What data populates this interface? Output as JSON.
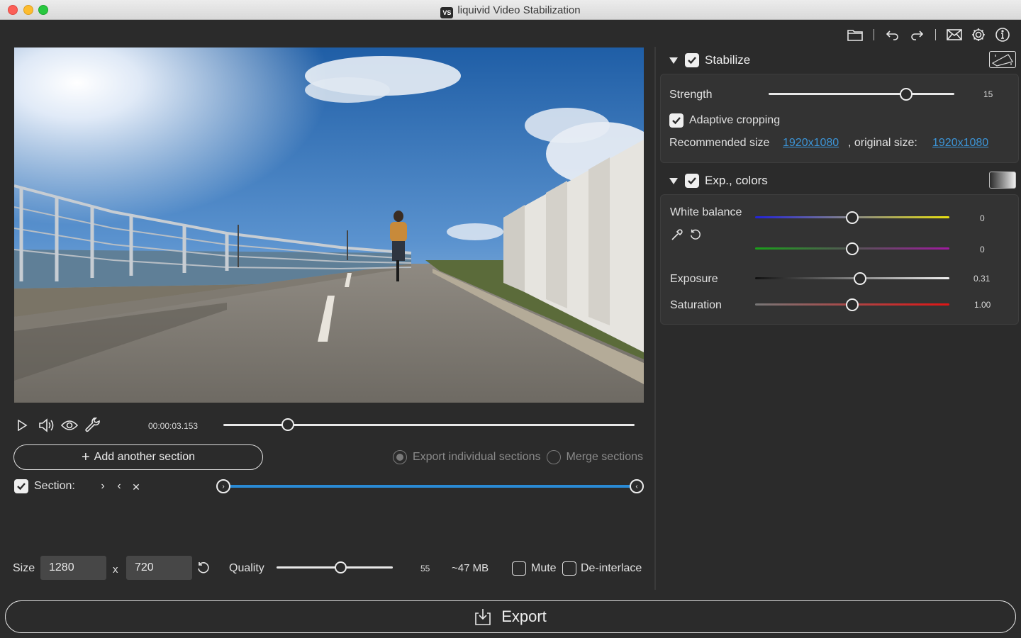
{
  "window": {
    "title": "liquivid Video Stabilization",
    "app_icon_text": "VS"
  },
  "toolbar": {
    "icons": [
      "folder-icon",
      "undo-icon",
      "redo-icon",
      "mail-icon",
      "gear-icon",
      "info-icon"
    ]
  },
  "player": {
    "timecode": "00:00:03.153",
    "position": 0.157
  },
  "sections": {
    "add_label": "Add another section",
    "export_individual_label": "Export individual sections",
    "merge_label": "Merge sections",
    "export_individual_selected": true,
    "section_label": "Section:",
    "section_checked": true,
    "range_start": 0.0,
    "range_end": 1.0
  },
  "output": {
    "size_label": "Size",
    "width": "1280",
    "x_label": "x",
    "height": "720",
    "quality_label": "Quality",
    "quality_value": "55",
    "quality_fraction": 0.55,
    "estimate": "~47 MB",
    "mute_label": "Mute",
    "mute_checked": false,
    "deinterlace_label": "De-interlace",
    "deinterlace_checked": false
  },
  "export": {
    "label": "Export"
  },
  "stabilize": {
    "title": "Stabilize",
    "enabled": true,
    "strength_label": "Strength",
    "strength_value": "15",
    "strength_fraction": 0.74,
    "adaptive_label": "Adaptive cropping",
    "adaptive_checked": true,
    "recommended_label": "Recommended size",
    "recommended_value": "1920x1080",
    "original_label": ", original size:",
    "original_value": "1920x1080"
  },
  "colors": {
    "title": "Exp., colors",
    "enabled": true,
    "white_balance_label": "White balance",
    "wb1_value": "0",
    "wb1_fraction": 0.5,
    "wb2_value": "0",
    "wb2_fraction": 0.5,
    "exposure_label": "Exposure",
    "exposure_value": "0.31",
    "exposure_fraction": 0.54,
    "saturation_label": "Saturation",
    "saturation_value": "1.00",
    "saturation_fraction": 0.5
  }
}
